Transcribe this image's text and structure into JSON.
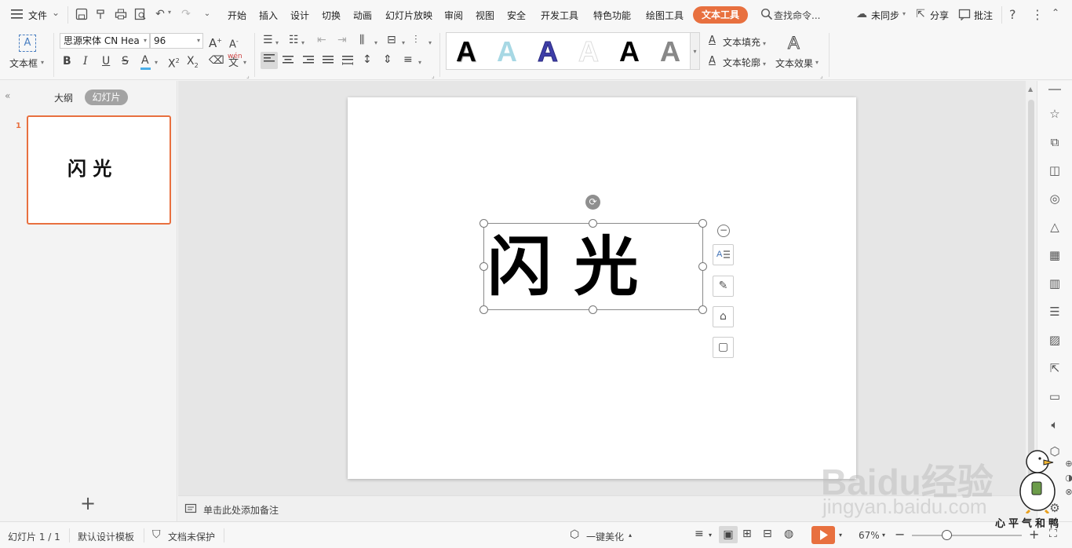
{
  "menubar": {
    "file_label": "文件",
    "tabs": [
      "开始",
      "插入",
      "设计",
      "切换",
      "动画",
      "幻灯片放映",
      "审阅",
      "视图",
      "安全",
      "开发工具",
      "特色功能",
      "绘图工具"
    ],
    "active_tab": "文本工具",
    "search_placeholder": "查找命令...",
    "sync_label": "未同步",
    "share_label": "分享",
    "comment_label": "批注",
    "help_icon": "?"
  },
  "ribbon": {
    "textbox_label": "文本框",
    "font_name": "思源宋体 CN Hea",
    "font_size": "96",
    "pinyin": "wén",
    "text_fill_label": "文本填充",
    "text_outline_label": "文本轮廓",
    "text_effect_label": "文本效果",
    "styles": [
      "A",
      "A",
      "A",
      "A",
      "A",
      "A"
    ]
  },
  "leftpanel": {
    "tab_outline": "大纲",
    "tab_slides": "幻灯片",
    "slide_number": "1",
    "thumb_text": "闪 光",
    "add_icon": "+"
  },
  "slide": {
    "title_text": "闪 光"
  },
  "notes": {
    "placeholder": "单击此处添加备注"
  },
  "status": {
    "slide_counter": "幻灯片 1 / 1",
    "template": "默认设计模板",
    "protection": "文档未保护",
    "beautify": "一键美化",
    "zoom": "67%"
  },
  "watermark": {
    "brand": "Baidu经验",
    "url": "jingyan.baidu.com",
    "motto": "心平气和鸭"
  },
  "colors": {
    "accent": "#e8703f",
    "selection_orange": "#e8703f"
  }
}
